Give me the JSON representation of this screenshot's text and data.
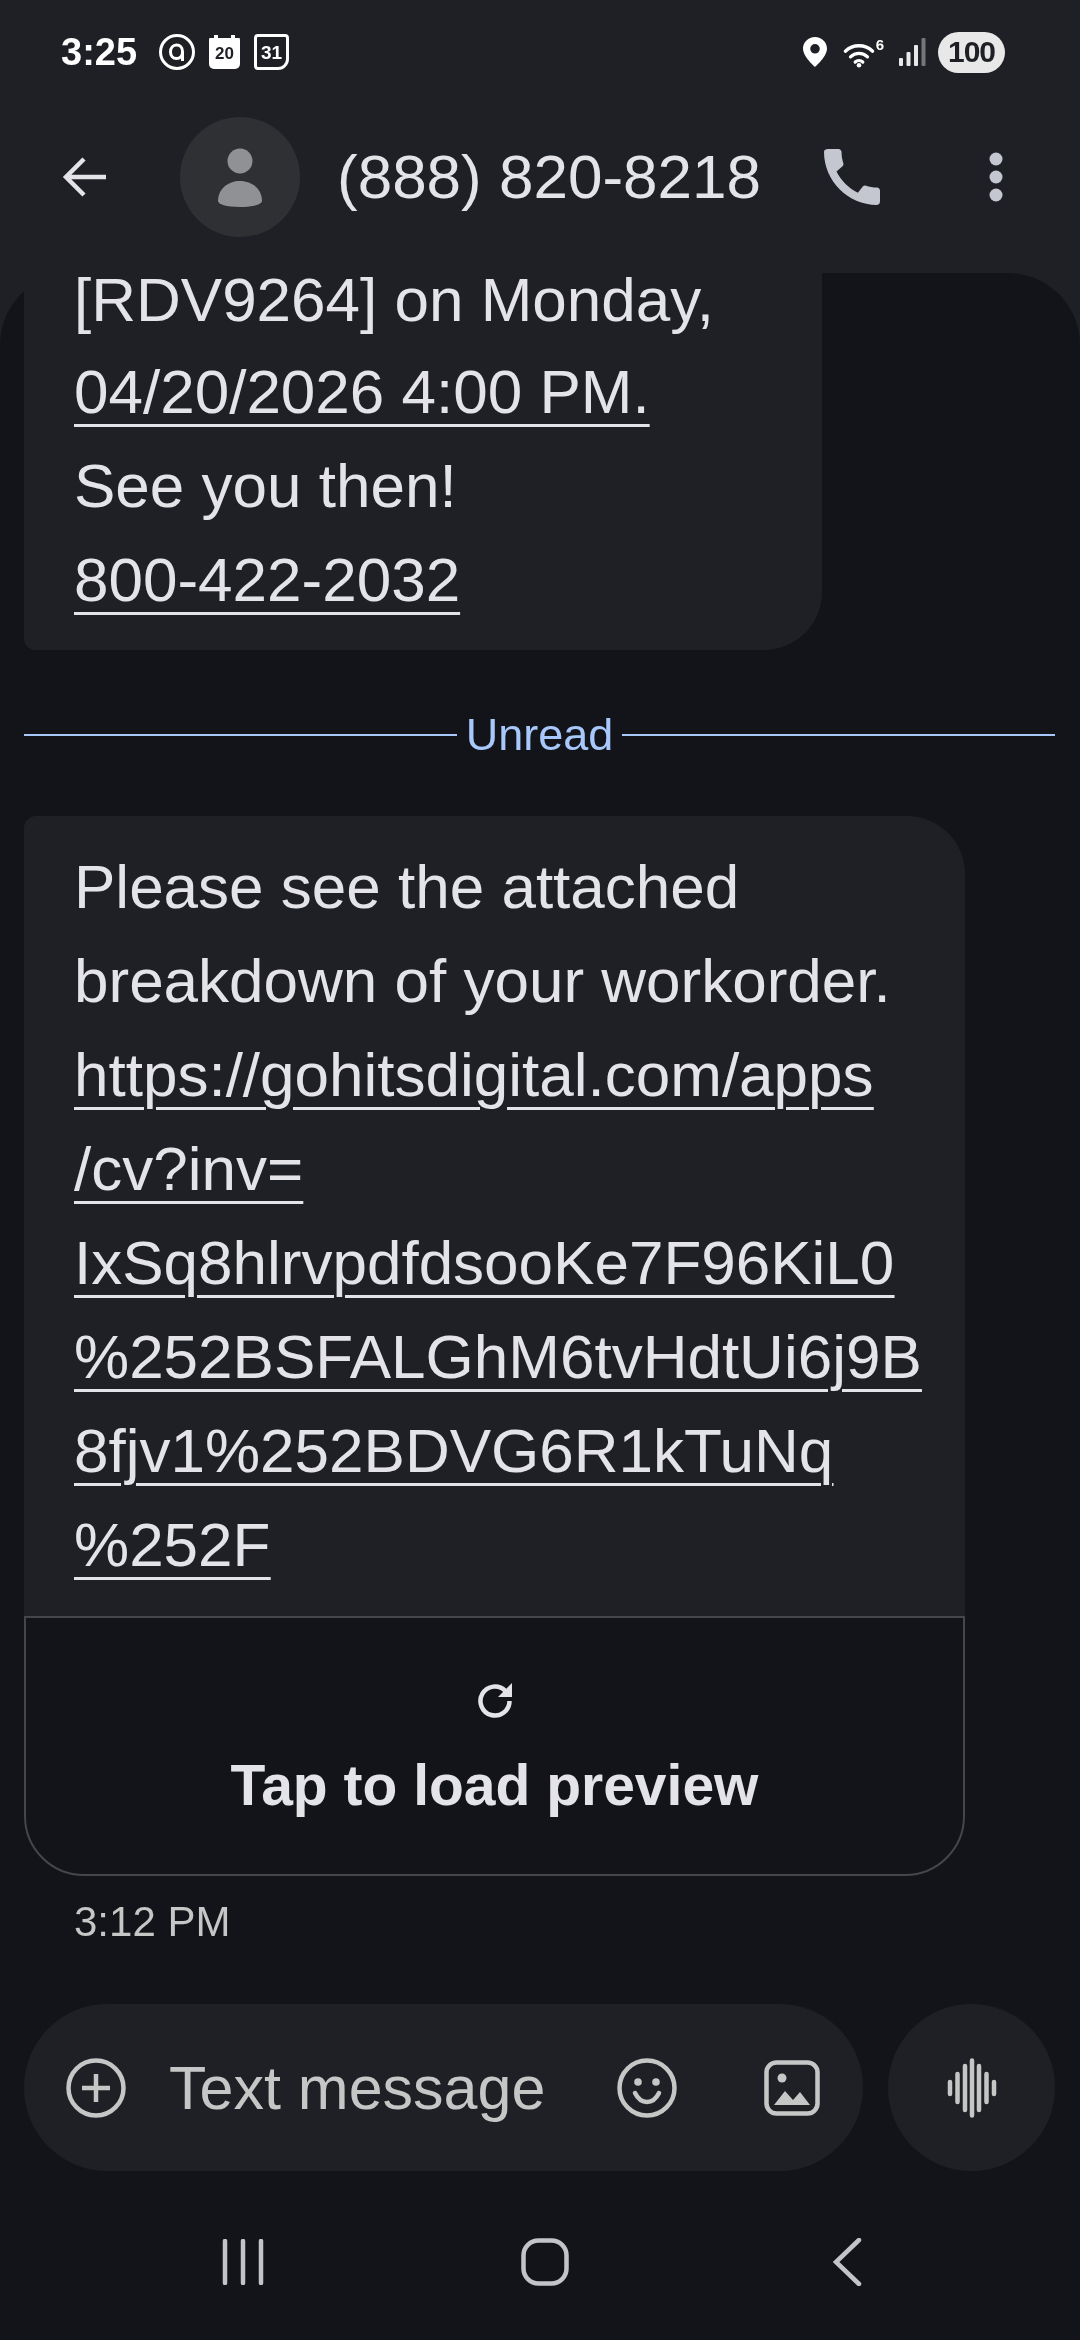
{
  "status_bar": {
    "time": "3:25",
    "notifications": [
      {
        "kind": "at-sign"
      },
      {
        "kind": "calendar-filled",
        "text": "20"
      },
      {
        "kind": "calendar-outline",
        "text": "31"
      }
    ],
    "wifi_label": "6",
    "battery": "100"
  },
  "header": {
    "title": "(888) 820-8218"
  },
  "thread": [
    {
      "kind": "message",
      "lines": [
        {
          "kind": "text",
          "text": "[RDV9264] on Monday,"
        },
        {
          "kind": "link",
          "text": "04/20/2026 4:00 PM."
        },
        {
          "kind": "text",
          "text": "See you then!"
        },
        {
          "kind": "link",
          "text": "800-422-2032"
        }
      ]
    },
    {
      "kind": "divider",
      "label": "Unread"
    },
    {
      "kind": "message",
      "lines": [
        {
          "kind": "text",
          "text": "Please see the attached breakdown of your workorder."
        },
        {
          "kind": "link",
          "lines": [
            "https://gohitsdigital.com/apps",
            "/cv?inv=",
            "IxSq8hlrvpdfdsooKe7F96KiL0",
            "%252BSFALGhM6tvHdtUi6j9B",
            "8fjv1%252BDVG6R1kTuNq",
            "%252F"
          ]
        }
      ],
      "link_preview": "Tap to load preview",
      "time": "3:12 PM"
    }
  ],
  "compose": {
    "placeholder": "Text message"
  }
}
